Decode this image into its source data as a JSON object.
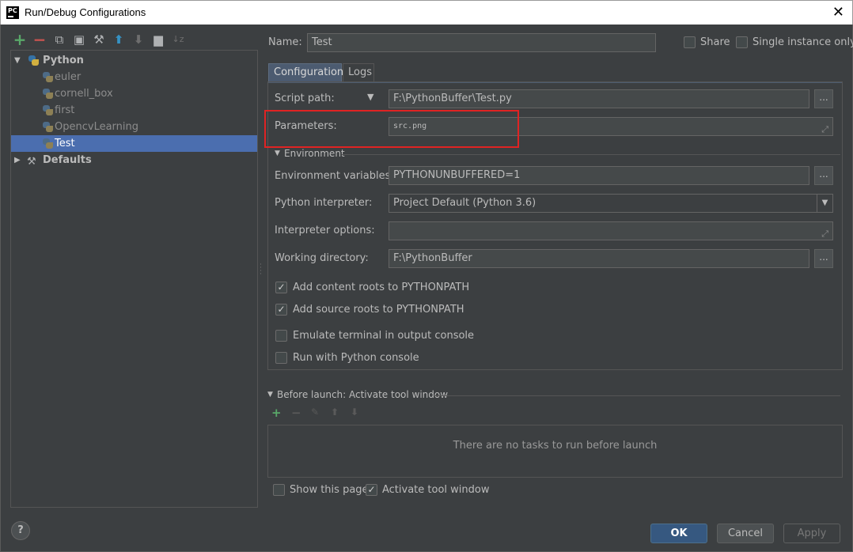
{
  "window": {
    "title": "Run/Debug Configurations",
    "icon_text": "PC",
    "close_glyph": "✕"
  },
  "toolbar": {
    "add": "+",
    "remove": "−",
    "copy": "⧉",
    "save": "▣",
    "edit_defaults": "⚒",
    "move_up": "⬆",
    "move_down": "⬇",
    "folder": "▆",
    "sort": "↓z"
  },
  "tree": {
    "python": {
      "label": "Python",
      "arrow": "▼"
    },
    "items": [
      {
        "label": "euler"
      },
      {
        "label": "cornell_box"
      },
      {
        "label": "first"
      },
      {
        "label": "OpencvLearning"
      },
      {
        "label": "Test"
      }
    ],
    "defaults": {
      "label": "Defaults",
      "arrow": "▶"
    }
  },
  "header": {
    "name_label": "Name:",
    "name_value": "Test",
    "share_label": "Share",
    "single_instance_label": "Single instance only"
  },
  "tabs": [
    {
      "label": "Configuration"
    },
    {
      "label": "Logs"
    }
  ],
  "config": {
    "script_path_label": "Script path:",
    "script_path_value": "F:\\PythonBuffer\\Test.py",
    "parameters_label": "Parameters:",
    "parameters_value": "src.png",
    "environment_section": "Environment",
    "env_vars_label": "Environment variables:",
    "env_vars_value": "PYTHONUNBUFFERED=1",
    "interpreter_label": "Python interpreter:",
    "interpreter_value": "Project Default (Python 3.6)",
    "interp_options_label": "Interpreter options:",
    "interp_options_value": "",
    "working_dir_label": "Working directory:",
    "working_dir_value": "F:\\PythonBuffer",
    "browse_label": "...",
    "checkboxes": [
      {
        "label": "Add content roots to PYTHONPATH",
        "checked": true
      },
      {
        "label": "Add source roots to PYTHONPATH",
        "checked": true
      },
      {
        "label": "Emulate terminal in output console",
        "checked": false
      },
      {
        "label": "Run with Python console",
        "checked": false
      }
    ]
  },
  "before_launch": {
    "title": "Before launch: Activate tool window",
    "empty_text": "There are no tasks to run before launch",
    "show_page_label": "Show this page",
    "activate_label": "Activate tool window"
  },
  "buttons": {
    "ok": "OK",
    "cancel": "Cancel",
    "apply": "Apply",
    "help": "?"
  }
}
